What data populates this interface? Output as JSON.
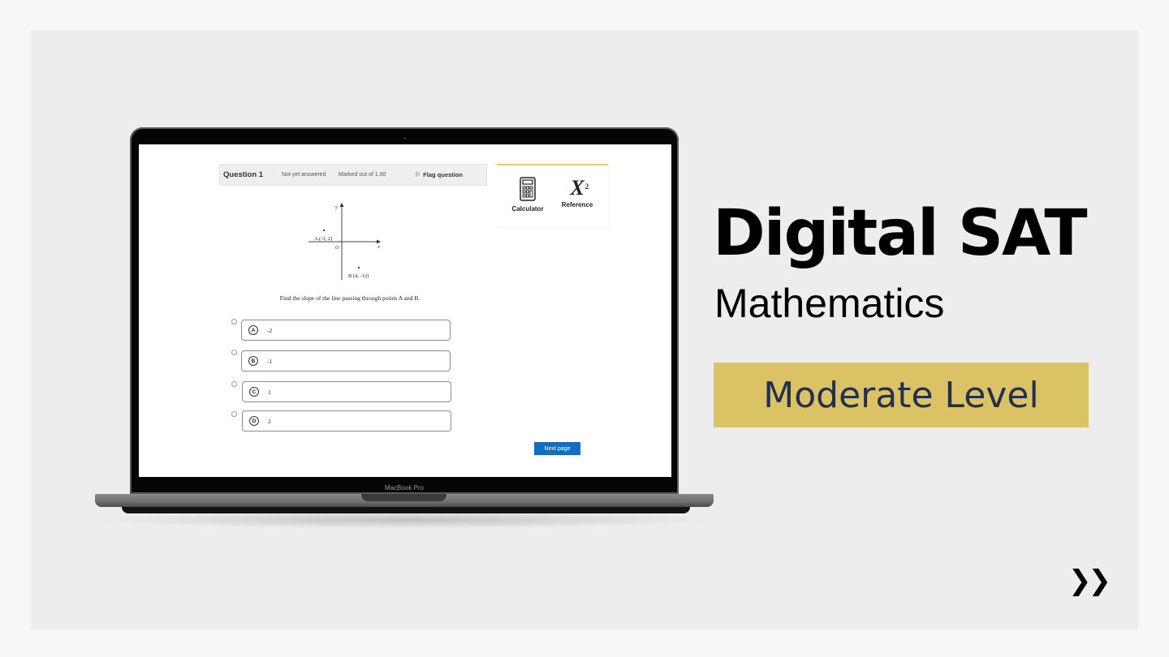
{
  "banner": {
    "title": "Digital SAT",
    "subtitle": "Mathematics",
    "level_badge": "Moderate Level",
    "level_badge_color": "#dbc264",
    "level_text_color": "#23304d",
    "forward_icon": "double-chevron-right-icon"
  },
  "laptop": {
    "model_label": "MacBook Pro"
  },
  "quiz": {
    "header": {
      "question_label": "Question 1",
      "status": "Not yet answered",
      "marks": "Marked out of 1.00",
      "flag_label": "Flag question",
      "flag_icon": "flag-icon"
    },
    "tools": [
      {
        "label": "Calculator",
        "icon": "calculator-icon"
      },
      {
        "label": "Reference",
        "icon": "x-squared-icon",
        "glyph": "X",
        "sup": "2"
      }
    ],
    "graph": {
      "x_axis_label": "x",
      "y_axis_label": "y",
      "origin_label": "O",
      "point_a_label": "A (-3, 2)",
      "point_b_label": "B (4, -12)"
    },
    "question_text": "Find the slope of the line passing through points A and B.",
    "choices": [
      {
        "letter": "A",
        "value": "-2"
      },
      {
        "letter": "B",
        "value": "-1"
      },
      {
        "letter": "C",
        "value": "1"
      },
      {
        "letter": "D",
        "value": "2"
      }
    ],
    "next_button": "Next page",
    "accent_color": "#0f6cc9"
  }
}
